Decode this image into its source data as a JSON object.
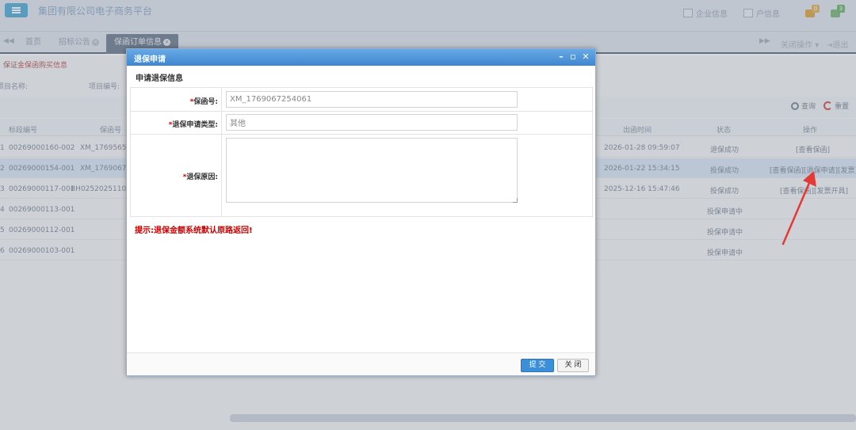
{
  "header": {
    "app_title": "集团有限公司电子商务平台",
    "links": [
      {
        "label": "企业信息",
        "icon": "enterprise-icon"
      },
      {
        "label": "户信息",
        "icon": "account-icon"
      }
    ],
    "badges": [
      {
        "count": "0",
        "icon": "message-icon",
        "color": "#e0b25c"
      },
      {
        "count": "3",
        "icon": "notification-icon",
        "color": "#6fb36f"
      }
    ]
  },
  "tabs": {
    "items": [
      {
        "label": "首页"
      },
      {
        "label": "招标公告"
      },
      {
        "label": "保函订单信息"
      }
    ],
    "right_actions": {
      "close_ops": "关闭操作",
      "exit": "退出"
    }
  },
  "page": {
    "section_title": "保证金保函购买信息",
    "filters": {
      "project_name": "项目名称:",
      "project_code": "项目编号:"
    },
    "toolbar": {
      "search": "查询",
      "reset": "重置"
    },
    "columns": {
      "code": "标段编号",
      "guarantee_no": "保函号",
      "issue_time": "出函时间",
      "status": "状态",
      "actions": "操作"
    },
    "rows": [
      {
        "idx": "1",
        "code": "00269000160-002",
        "guarantee_no": "XM_17695655",
        "issue_time": "2026-01-28 09:59:07",
        "status": "退保成功",
        "actions": "[查看保函]"
      },
      {
        "idx": "2",
        "code": "00269000154-001",
        "guarantee_no": "XM_17690672",
        "issue_time": "2026-01-22 15:34:15",
        "status": "投保成功",
        "actions": "[查看保函][退保申请][发票]"
      },
      {
        "idx": "3",
        "code": "00269000117-001",
        "guarantee_no": "BH025202511040",
        "issue_time": "2025-12-16 15:47:46",
        "status": "投保成功",
        "actions": "[查看保函][发票开具]"
      },
      {
        "idx": "4",
        "code": "00269000113-001",
        "guarantee_no": "",
        "issue_time": "",
        "status": "投保申请中",
        "actions": ""
      },
      {
        "idx": "5",
        "code": "00269000112-001",
        "guarantee_no": "",
        "issue_time": "",
        "status": "投保申请中",
        "actions": ""
      },
      {
        "idx": "6",
        "code": "00269000103-001",
        "guarantee_no": "",
        "issue_time": "",
        "status": "投保申请中",
        "actions": ""
      }
    ]
  },
  "modal": {
    "title": "退保申请",
    "fieldset_title": "申请退保信息",
    "fields": {
      "guarantee_no_label": "保函号:",
      "guarantee_no_value": "XM_1769067254061",
      "type_label": "退保申请类型:",
      "type_value": "其他",
      "reason_label": "退保原因:",
      "reason_value": ""
    },
    "required_mark": "*",
    "tip": "提示:退保金额系统默认原路返回!",
    "buttons": {
      "submit": "提 交",
      "close": "关 闭"
    }
  },
  "colors": {
    "header_blue": "#4a93d9",
    "tip_red": "#cc0000",
    "annotation_red": "#e53935",
    "primary": "#3c8ed6"
  }
}
